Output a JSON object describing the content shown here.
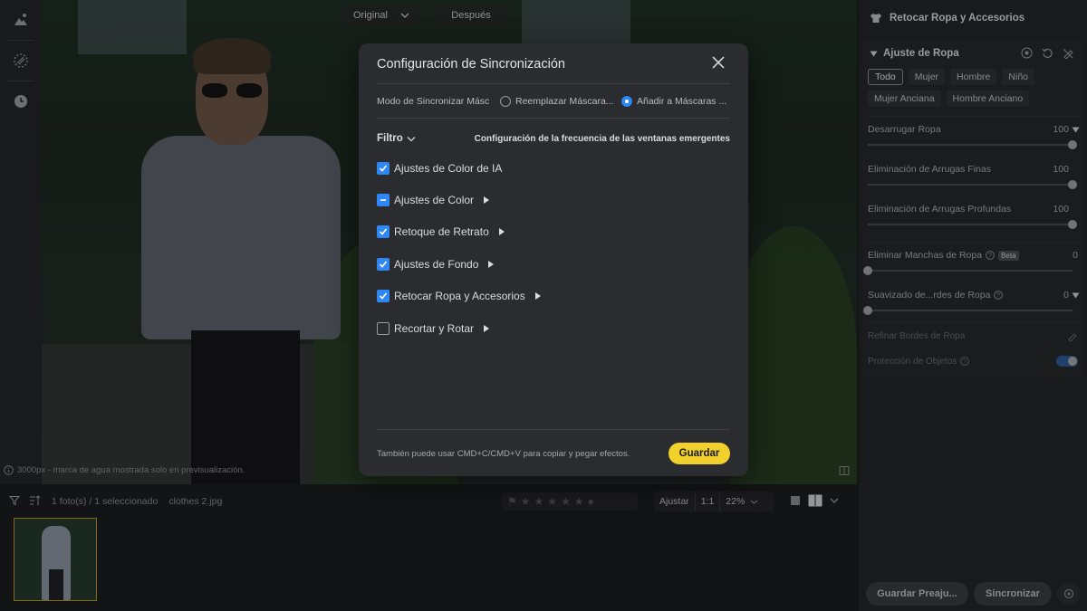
{
  "canvas": {
    "view_original": "Original",
    "view_after": "Después",
    "watermark_note": "3000px - marca de agua mostrada solo en previsualización."
  },
  "bottom_bar": {
    "count": "1 foto(s) / 1 seleccionado",
    "filename": "clothes 2.jpg",
    "fit": "Ajustar",
    "one_to_one": "1:1",
    "zoom": "22%"
  },
  "right_panel": {
    "title": "Retocar Ropa y Accesorios",
    "section_title": "Ajuste de Ropa",
    "chips": [
      "Todo",
      "Mujer",
      "Hombre",
      "Niño",
      "Mujer Anciana",
      "Hombre Anciano"
    ],
    "active_chip": "Todo",
    "sliders": [
      {
        "label": "Desarrugar Ropa",
        "value": "100",
        "fraction": 1.0
      },
      {
        "label": "Eliminación de Arrugas Finas",
        "value": "100",
        "fraction": 1.0
      },
      {
        "label": "Eliminación de Arrugas Profundas",
        "value": "100",
        "fraction": 1.0
      },
      {
        "label": "Eliminar Manchas de Ropa",
        "value": "0",
        "fraction": 0.0,
        "badge": "Beta"
      },
      {
        "label": "Suavizado de...rdes de Ropa",
        "value": "0",
        "fraction": 0.0
      }
    ],
    "refine_label": "Refinar Bordes de Ropa",
    "protect_label": "Protección de Objetos",
    "save_preset": "Guardar Preaju...",
    "sync": "Sincronizar"
  },
  "modal": {
    "title": "Configuración de Sincronización",
    "mode_label": "Modo de Sincronizar Másc",
    "option_replace": "Reemplazar Máscara...",
    "option_add": "Añadir a Máscaras ...",
    "filter": "Filtro",
    "freq_link": "Configuración de la frecuencia de las ventanas emergentes",
    "items": [
      {
        "label": "Ajustes de Color de IA",
        "state": "checked"
      },
      {
        "label": "Ajustes de Color",
        "state": "partial"
      },
      {
        "label": "Retoque de Retrato",
        "state": "checked"
      },
      {
        "label": "Ajustes de Fondo",
        "state": "checked"
      },
      {
        "label": "Retocar Ropa y Accesorios",
        "state": "checked"
      },
      {
        "label": "Recortar y Rotar",
        "state": "unchecked"
      }
    ],
    "hint": "También puede usar CMD+C/CMD+V para copiar y pegar efectos.",
    "save": "Guardar"
  },
  "colors": {
    "accent_blue": "#2f86f5",
    "save_yellow": "#f2d12c"
  }
}
